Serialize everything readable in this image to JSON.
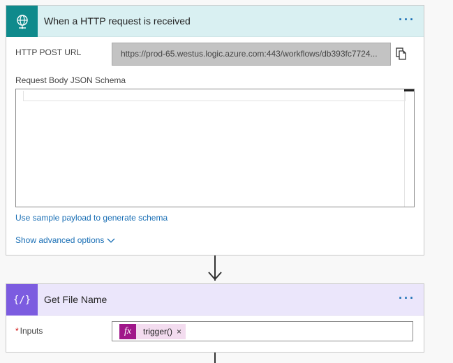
{
  "trigger_card": {
    "title": "When a HTTP request is received",
    "icon": "globe-network-icon",
    "accent_color": "#0f8a8c",
    "header_bg": "#d9f0f2",
    "more_label": "···",
    "url_label": "HTTP POST URL",
    "url_value": "https://prod-65.westus.logic.azure.com:443/workflows/db393fc7724...",
    "schema_label": "Request Body JSON Schema",
    "schema_value": "",
    "sample_payload_link": "Use sample payload to generate schema",
    "advanced_options_link": "Show advanced options"
  },
  "compose_card": {
    "title": "Get File Name",
    "icon": "braces-icon",
    "icon_text": "{∕}",
    "accent_color": "#7c5ce0",
    "header_bg": "#ebe6fb",
    "more_label": "···",
    "inputs_label": "Inputs",
    "required_marker": "*",
    "token": {
      "fx_label": "fx",
      "text": "trigger()",
      "remove_label": "×",
      "color": "#a0178a"
    }
  }
}
